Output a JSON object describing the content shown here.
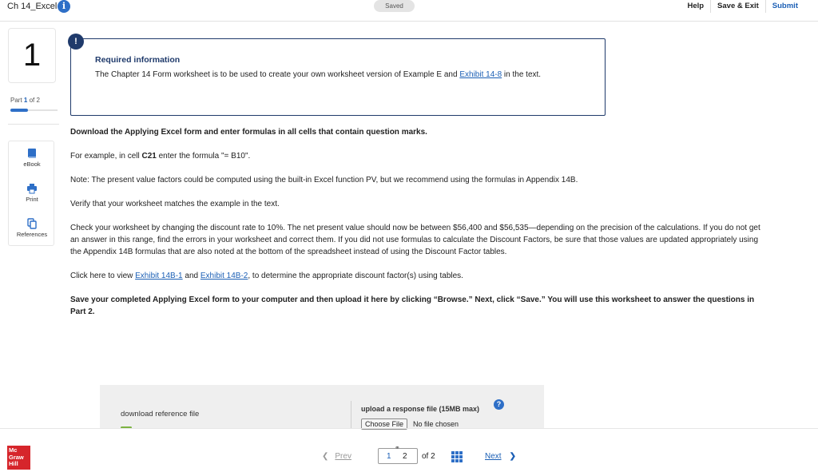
{
  "header": {
    "title": "Ch 14_Excel",
    "saved_label": "Saved",
    "nav": {
      "help": "Help",
      "save_exit": "Save & Exit",
      "submit": "Submit"
    }
  },
  "rail": {
    "question_number": "1",
    "part_prefix": "Part",
    "part_current": "1",
    "part_suffix": "of 2",
    "part_progress": 0.5,
    "tools": {
      "ebook": "eBook",
      "print": "Print",
      "references": "References"
    }
  },
  "info": {
    "badge": "!",
    "heading": "Required information",
    "text_before": "The Chapter 14 Form worksheet is to be used to create your own worksheet version of Example E and ",
    "link": "Exhibit 14-8",
    "text_after": " in the text."
  },
  "content": {
    "p1": "Download the Applying Excel form and enter formulas in all cells that contain question marks.",
    "p2_before": "For example, in cell ",
    "p2_cell": "C21",
    "p2_after": " enter the formula \"= B10\".",
    "p3": "Note: The present value factors could be computed using the built-in Excel function PV, but we recommend using the formulas in Appendix 14B.",
    "p4": "Verify that your worksheet matches the example in the text.",
    "p5": "Check your worksheet by changing the discount rate to 10%. The net present value should now be between $56,400 and $56,535—depending on the precision of the calculations. If you do not get an answer in this range, find the errors in your worksheet and correct them. If you did not use formulas to calculate the Discount Factors, be sure that those values are updated appropriately using the Appendix 14B formulas that are also noted at the bottom of the spreadsheet instead of using the Discount Factor tables.",
    "p6_before": "Click here to view ",
    "p6_link1": "Exhibit 14B-1",
    "p6_mid": " and ",
    "p6_link2": "Exhibit 14B-2",
    "p6_after": ", to determine the appropriate discount factor(s) using tables.",
    "p7": "Save your completed Applying Excel form to your computer and then upload it here by clicking “Browse.” Next, click “Save.” You will use this worksheet to answer the questions in Part 2."
  },
  "files": {
    "download_label": "download reference file",
    "upload_label": "upload a response file (15MB max)",
    "help_icon": "?",
    "choose_button": "Choose File",
    "no_file": "No file chosen"
  },
  "footer": {
    "logo_line1": "Mc",
    "logo_line2": "Graw",
    "logo_line3": "Hill",
    "prev": "Prev",
    "page1": "1",
    "page2": "2",
    "of": "of 2",
    "next": "Next"
  },
  "colors": {
    "accent": "#1b5fb5",
    "navy": "#1f3a6b",
    "brand": "#d6252b"
  }
}
